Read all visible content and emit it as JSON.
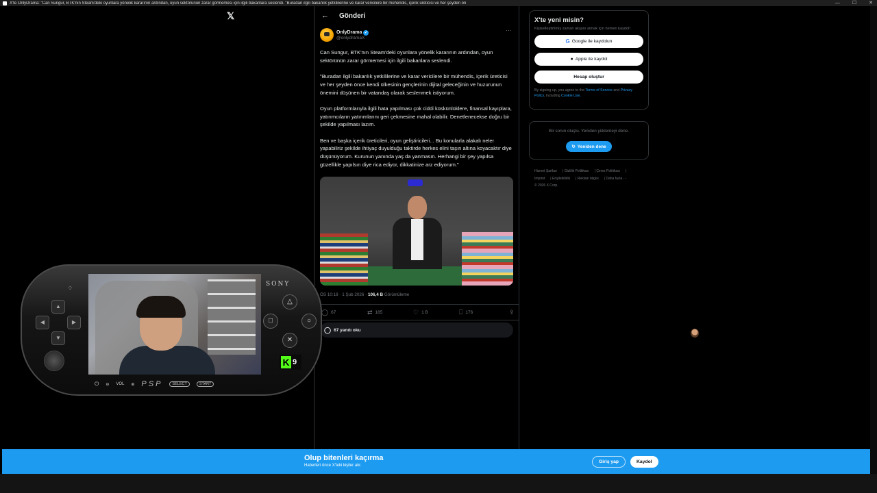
{
  "window": {
    "title": "X'te OnlyDrama: \"Can Sungur, BTK'nın Steam'deki oyunlara yönelik kararının ardından, oyun sektörünün zarar görmemesi için ilgili bakanlara seslendi. \"Buradan ilgili bakanlık yetkililerine ve karar vericilere bir mühendis, içerik üreticisi ve her şeyden ön",
    "minimize": "—",
    "maximize": "☐",
    "close": "✕"
  },
  "logo": "𝕏",
  "header": {
    "back": "←",
    "title": "Gönderi"
  },
  "tweet": {
    "author": "OnlyDrama",
    "handle": "@onlydramaX",
    "more": "···",
    "paragraphs": [
      "Can Sungur, BTK'nın Steam'deki oyunlara yönelik kararının ardından, oyun sektörünün zarar görmemesi için ilgili bakanlara seslendi.",
      "\"Buradan ilgili bakanlık yetkililerine ve karar vericilere bir mühendis, içerik üreticisi ve her şeyden önce kendi ülkesinin gençlerinin dijital geleceğinin ve huzurunun önemini düşünen bir vatandaş olarak seslenmek istiyorum.",
      "Oyun platformlarıyla ilgili hata yapılması çok ciddi küskünlüklere, finansal kayıplara, yatırımcıların yatırımlarını geri çekmesine mahal olabilir. Denetlenecekse doğru bir şekilde yapılması lazım.",
      "Ben ve başka içerik üreticileri, oyun geliştiricileri... Bu konularla alakalı neler yapabiliriz şekilde ihtiyaç duyulduğu taktirde herkes elini taşın altına koyacaktır diye düşünüyorum. Kurunun yanında yaş da yanmasın. Herhangi bir şey yapılsa güzellikle yapılsın diye rica ediyor, dikkatinize arz ediyorum.\""
    ],
    "time": "ÖS 10:18 · 1 Şub 2026 · ",
    "views": "106,4 B",
    "views_label": " Görüntüleme",
    "replies": "67",
    "reposts": "185",
    "likes": "1 B",
    "bookmarks": "176",
    "read_replies": "67 yanıtı oku"
  },
  "sidebar": {
    "title": "X'te yeni misin?",
    "subtitle": "Kişiselleştirilmiş zaman akışını almak için hemen kaydol!",
    "google": "Google ile kaydolun",
    "apple": "Apple ile kaydol",
    "create": "Hesap oluştur",
    "legal_1": "By signing up, you agree to the ",
    "terms": "Terms of Service",
    "legal_2": " and ",
    "privacy": "Privacy Policy",
    "legal_3": ", including ",
    "cookie": "Cookie Use.",
    "error": "Bir sorun oluştu. Yeniden yüklemeyi dene.",
    "retry": "Yeniden dene",
    "footer": [
      "Hizmet Şartları",
      "Gizlilik Politikası",
      "Çerez Politikası",
      "Imprint",
      "Erişilebilirlik",
      "Reklam bilgisi",
      "Daha fazla ···",
      "© 2026 X Corp."
    ]
  },
  "psp": {
    "brand": "SONY",
    "vol": "VOL",
    "logo": "PSP",
    "select": "SELECT",
    "start": "START",
    "kick_k": "K",
    "kick_num": "9",
    "triangle": "△",
    "circle": "○",
    "cross": "✕",
    "square": "□"
  },
  "banner": {
    "title": "Olup bitenleri kaçırma",
    "subtitle": "Haberleri önce X'teki kişiler alır.",
    "login": "Giriş yap",
    "signup": "Kaydol"
  }
}
